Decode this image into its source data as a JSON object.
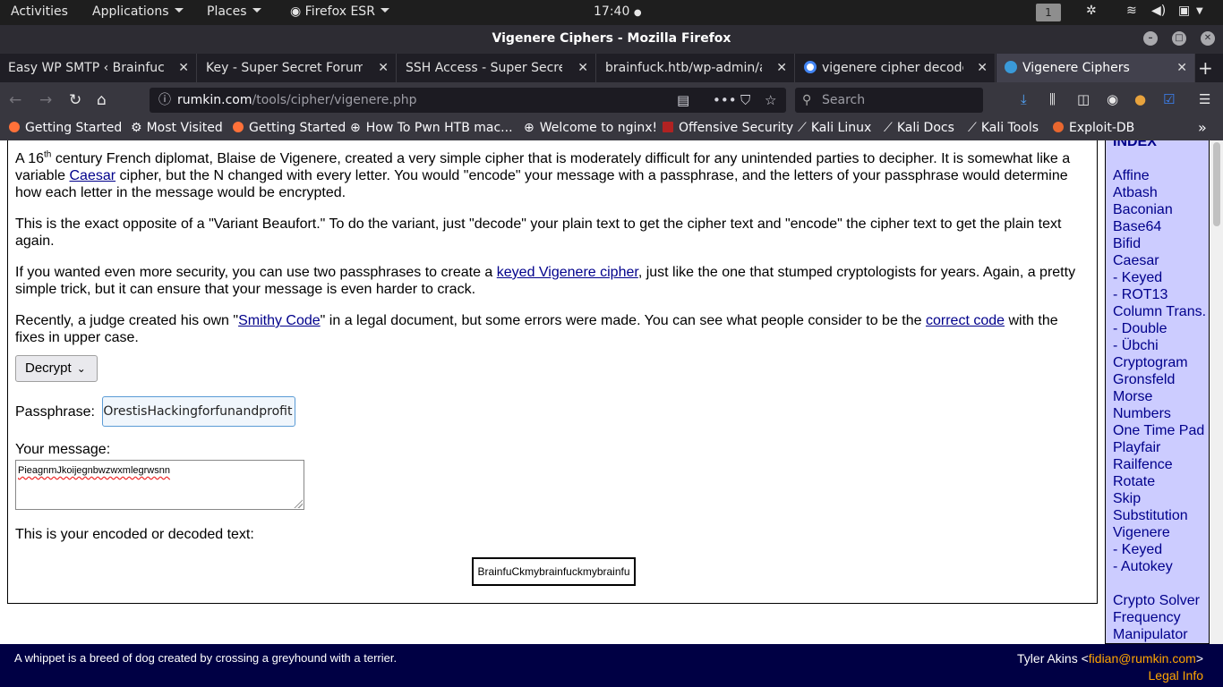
{
  "topbar": {
    "activities": "Activities",
    "applications": "Applications",
    "places": "Places",
    "firefox": "Firefox ESR",
    "clock": "17:40",
    "workspace": "1"
  },
  "window": {
    "title": "Vigenere Ciphers - Mozilla Firefox"
  },
  "tabs": [
    {
      "label": "Easy WP SMTP ‹ Brainfuck ‹",
      "favicon_color": "#5f5f66"
    },
    {
      "label": "Key - Super Secret Forum",
      "favicon_color": "#5f5f66"
    },
    {
      "label": "SSH Access - Super Secret F",
      "favicon_color": "#5f5f66"
    },
    {
      "label": "brainfuck.htb/wp-admin/ad",
      "favicon_color": "#5f5f66"
    },
    {
      "label": "vigenere cipher decoder",
      "favicon_color": "#4285f4"
    },
    {
      "label": "Vigenere Ciphers",
      "favicon_color": "#3a9ad9"
    }
  ],
  "nav": {
    "url_host": "rumkin.com",
    "url_path": "/tools/cipher/vigenere.php",
    "search_placeholder": "Search"
  },
  "bookmarks": [
    {
      "label": "Getting Started",
      "icon": "firefox-icon",
      "color": "#ff7139"
    },
    {
      "label": "Most Visited",
      "icon": "gear-icon",
      "color": "#cccccc"
    },
    {
      "label": "Getting Started",
      "icon": "firefox-icon",
      "color": "#ff7139"
    },
    {
      "label": "How To Pwn HTB mac...",
      "icon": "globe-icon",
      "color": "#cccccc"
    },
    {
      "label": "Welcome to nginx!",
      "icon": "globe-icon",
      "color": "#cccccc"
    },
    {
      "label": "Offensive Security",
      "icon": "offsec-icon",
      "color": "#b02222"
    },
    {
      "label": "Kali Linux",
      "icon": "kali-icon",
      "color": "#dddddd"
    },
    {
      "label": "Kali Docs",
      "icon": "kali-icon",
      "color": "#dddddd"
    },
    {
      "label": "Kali Tools",
      "icon": "kali-icon",
      "color": "#dddddd"
    },
    {
      "label": "Exploit-DB",
      "icon": "exploitdb-icon",
      "color": "#e8672f"
    }
  ],
  "content": {
    "p1_a": "A 16",
    "p1_sup": "th",
    "p1_b": " century French diplomat, Blaise de Vigenere, created a very simple cipher that is moderately difficult for any unintended parties to decipher. It is somewhat like a variable ",
    "p1_link": "Caesar",
    "p1_c": " cipher, but the N changed with every letter. You would \"encode\" your message with a passphrase, and the letters of your passphrase would determine how each letter in the message would be encrypted.",
    "p2": "This is the exact opposite of a \"Variant Beaufort.\" To do the variant, just \"decode\" your plain text to get the cipher text and \"encode\" the cipher text to get the plain text again.",
    "p3_a": "If you wanted even more security, you can use two passphrases to create a ",
    "p3_link": "keyed Vigenere cipher",
    "p3_b": ", just like the one that stumped cryptologists for years. Again, a pretty simple trick, but it can ensure that your message is even harder to crack.",
    "p4_a": "Recently, a judge created his own \"",
    "p4_link1": "Smithy Code",
    "p4_b": "\" in a legal document, but some errors were made. You can see what people consider to be the ",
    "p4_link2": "correct code",
    "p4_c": " with the fixes in upper case.",
    "mode_selected": "Decrypt",
    "pass_label": "Passphrase:",
    "pass_value": "OrestisHackingforfunandprofit",
    "msg_label": "Your message:",
    "msg_value": "PieagnmJkoijegnbwzwxmlegrwsnn",
    "out_label": "This is your encoded or decoded text:",
    "out_value": "BrainfuCkmybrainfuckmybrainfu"
  },
  "index": {
    "heading": "INDEX",
    "items": [
      "Affine",
      "Atbash",
      "Baconian",
      "Base64",
      "Bifid",
      "Caesar",
      "- Keyed",
      "- ROT13",
      "Column Trans.",
      "- Double",
      "- Übchi",
      "Cryptogram",
      "Gronsfeld",
      "Morse",
      "Numbers",
      "One Time Pad",
      "Playfair",
      "Railfence",
      "Rotate",
      "Skip",
      "Substitution",
      "Vigenere",
      "- Keyed",
      "- Autokey",
      "",
      "Crypto Solver",
      "Frequency",
      "Manipulator"
    ]
  },
  "footer": {
    "quote": "A whippet is a breed of dog created by crossing a greyhound with a terrier.",
    "author_name": "Tyler Akins <",
    "author_email": "fidian@rumkin.com",
    "author_close": ">",
    "legal": "Legal Info"
  },
  "colors": {
    "index_bg": "#ccccff",
    "footer_bg": "#000044",
    "link": "#00008b",
    "footer_accent": "#ffa500"
  }
}
